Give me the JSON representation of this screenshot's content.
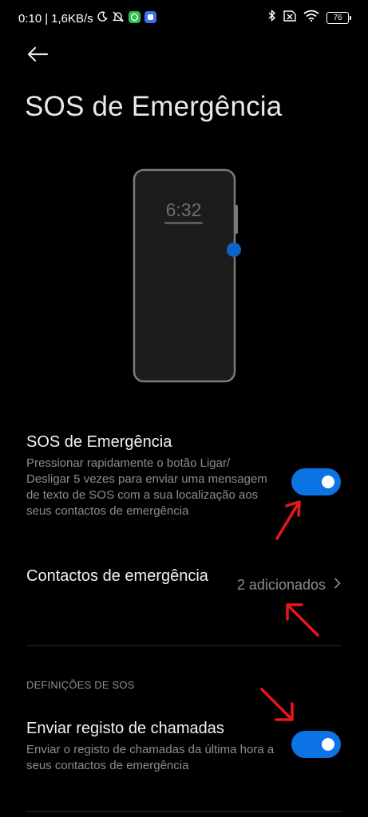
{
  "status_bar": {
    "time": "0:10",
    "separator": "|",
    "speed": "1,6KB/s",
    "battery": "76"
  },
  "header": {
    "title": "SOS de Emergência"
  },
  "illustration": {
    "clock": "6:32"
  },
  "sos_setting": {
    "title": "SOS de Emergência",
    "description": "Pressionar rapidamente o botão Ligar/ Desligar 5 vezes para enviar uma mensagem de texto de SOS com a sua localização aos seus contactos de emergência",
    "enabled": true
  },
  "contacts_setting": {
    "title": "Contactos de emergência",
    "value": "2 adicionados"
  },
  "section": {
    "header": "DEFINIÇÕES DE SOS"
  },
  "call_log_setting": {
    "title": "Enviar registo de chamadas",
    "description": "Enviar o registo de chamadas da última hora a seus contactos de emergência",
    "enabled": true
  },
  "colors": {
    "accent": "#0c73e4",
    "annotation_arrow": "#e8171b",
    "background": "#000000"
  }
}
